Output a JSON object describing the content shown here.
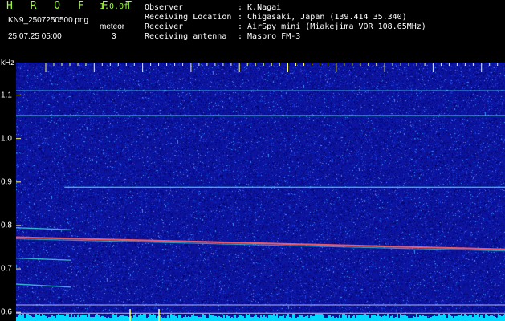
{
  "header": {
    "brand": "H R O F F T",
    "version": "1.0.0f",
    "filename": "KN9_2507250500.png",
    "datetime": "25.07.25 05:00",
    "meteor_label": "meteor",
    "meteor_count": "3"
  },
  "metadata": [
    {
      "key": "Observer",
      "value": ": K.Nagai"
    },
    {
      "key": "Receiving Location",
      "value": ": Chigasaki, Japan (139.414 35.340)"
    },
    {
      "key": "Receiver",
      "value": ": AirSpy mini (Miakejima VOR 108.65MHz)"
    },
    {
      "key": "Receiving antenna",
      "value": ": Maspro FM-3"
    }
  ],
  "chart_data": {
    "type": "heatmap",
    "ylabel": "kHz",
    "ylim": [
      0.58,
      1.175
    ],
    "time_ticks": [
      "0501",
      "0502",
      "0503",
      "0504",
      "0505",
      "0506",
      "0507",
      "0508",
      "0509",
      "0510"
    ],
    "freq_ticks": [
      1.1,
      1.0,
      0.9,
      0.8,
      0.7,
      0.6
    ],
    "traces": [
      {
        "start_time_min": 0.0,
        "end_time_min": 10.0,
        "start_khz": 1.053,
        "end_khz": 1.053
      },
      {
        "start_time_min": 0.0,
        "end_time_min": 10.0,
        "start_khz": 1.11,
        "end_khz": 1.11
      },
      {
        "start_time_min": 0.0,
        "end_time_min": 10.0,
        "start_khz": 0.773,
        "end_khz": 0.745
      },
      {
        "start_time_min": 1.0,
        "end_time_min": 10.0,
        "start_khz": 0.888,
        "end_khz": 0.888
      },
      {
        "start_time_min": 0.0,
        "end_time_min": 0.8,
        "start_khz": 0.795,
        "end_khz": 0.79
      },
      {
        "start_time_min": 0.0,
        "end_time_min": 0.8,
        "start_khz": 0.725,
        "end_khz": 0.72
      },
      {
        "start_time_min": 0.0,
        "end_time_min": 0.8,
        "start_khz": 0.665,
        "end_khz": 0.658
      }
    ],
    "background_color": "#0c14a8",
    "trace_color": "#40e0e0",
    "main_trace_color": "#ff6060",
    "bottom_strip_color": "#00d8ff"
  }
}
